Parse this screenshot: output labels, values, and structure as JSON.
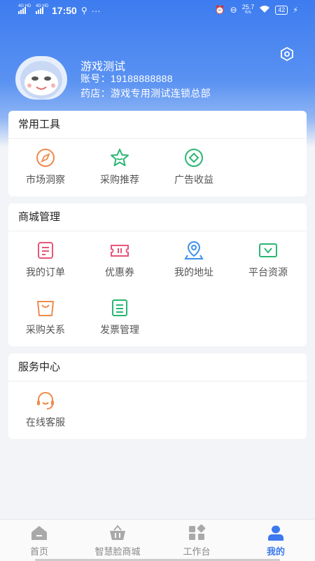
{
  "status_bar": {
    "network1": "4G HD",
    "network2": "4G HD",
    "time": "17:50",
    "more": "···",
    "speed": "25.7",
    "speed_unit": "K/s",
    "battery": "42"
  },
  "profile": {
    "name": "游戏测试",
    "account": "账号：19188888888",
    "pharmacy": "药店：游戏专用测试连锁总部"
  },
  "sections": [
    {
      "title": "常用工具",
      "items": [
        {
          "label": "市场洞察",
          "icon": "compass-icon",
          "color": "#f08a4b"
        },
        {
          "label": "采购推荐",
          "icon": "star-icon",
          "color": "#2bb673"
        },
        {
          "label": "广告收益",
          "icon": "diamond-icon",
          "color": "#2bb673"
        }
      ]
    },
    {
      "title": "商城管理",
      "items": [
        {
          "label": "我的订单",
          "icon": "order-icon",
          "color": "#e8557a"
        },
        {
          "label": "优惠券",
          "icon": "coupon-icon",
          "color": "#e8557a"
        },
        {
          "label": "我的地址",
          "icon": "location-icon",
          "color": "#3c8ff0"
        },
        {
          "label": "平台资源",
          "icon": "tv-icon",
          "color": "#2bb673"
        },
        {
          "label": "采购关系",
          "icon": "bag-icon",
          "color": "#f08a4b"
        },
        {
          "label": "发票管理",
          "icon": "invoice-icon",
          "color": "#2bb673"
        }
      ]
    },
    {
      "title": "服务中心",
      "items": [
        {
          "label": "在线客服",
          "icon": "headset-icon",
          "color": "#f08a4b"
        }
      ]
    }
  ],
  "tabbar": [
    {
      "label": "首页",
      "icon": "home-icon",
      "active": false
    },
    {
      "label": "智慧脸商城",
      "icon": "basket-icon",
      "active": false
    },
    {
      "label": "工作台",
      "icon": "workbench-icon",
      "active": false
    },
    {
      "label": "我的",
      "icon": "user-icon",
      "active": true
    }
  ],
  "colors": {
    "accent": "#3c78f0",
    "header_top": "#3d7cf0"
  }
}
